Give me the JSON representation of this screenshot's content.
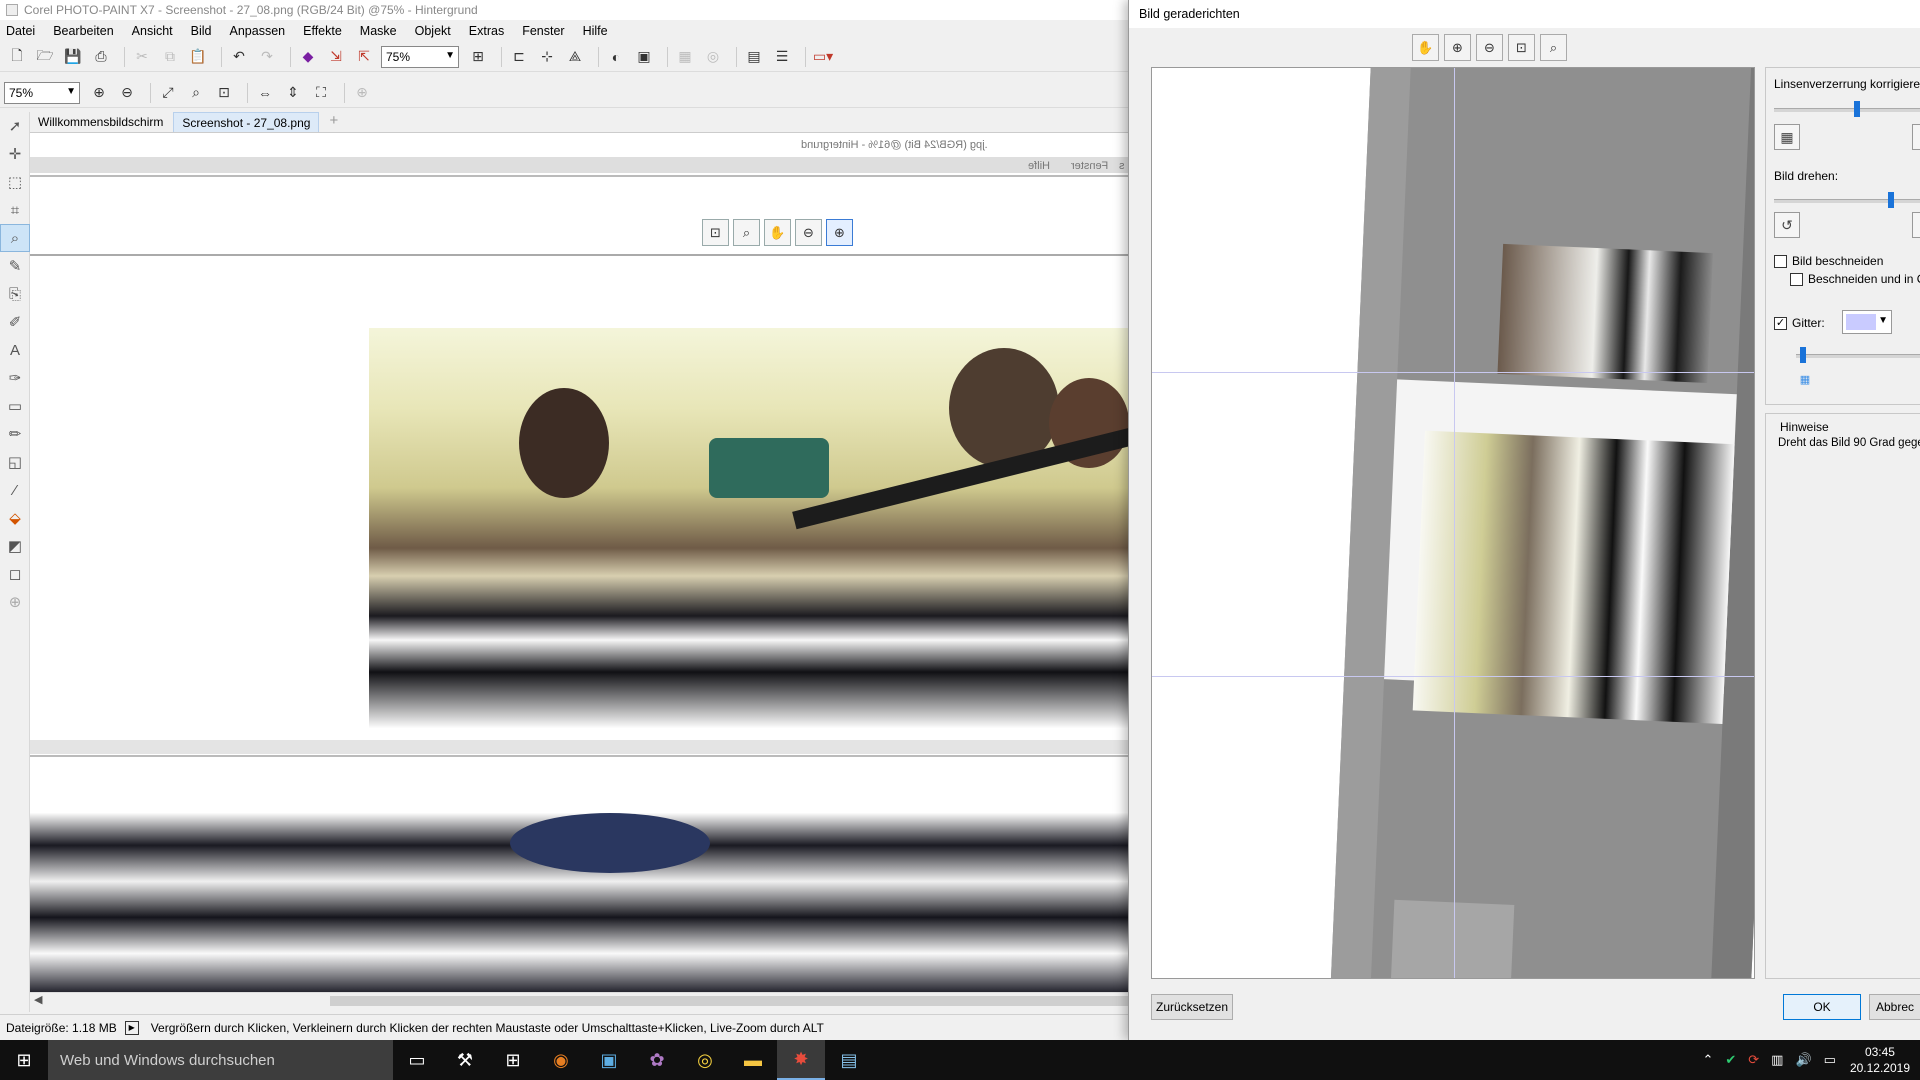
{
  "app": {
    "title": "Corel PHOTO-PAINT X7 - Screenshot - 27_08.png (RGB/24 Bit) @75% - Hintergrund",
    "menu": [
      "Datei",
      "Bearbeiten",
      "Ansicht",
      "Bild",
      "Anpassen",
      "Effekte",
      "Maske",
      "Objekt",
      "Extras",
      "Fenster",
      "Hilfe"
    ],
    "zoom_main": "75%",
    "zoom_secondary": "75%",
    "tabs": [
      "Willkommensbildschirm",
      "Screenshot - 27_08.png"
    ],
    "tab_add": "+",
    "mirrored_title": ".jpg (RGB/24 Bit) @61% - Hintergrund",
    "mirrored_menu": [
      "Hilfe",
      "Fenster",
      "s"
    ]
  },
  "status": {
    "filesize": "Dateigröße: 1.18 MB",
    "hint": "Vergrößern durch Klicken, Verkleinern durch Klicken der rechten Maustaste oder Umschalttaste+Klicken, Live-Zoom durch ALT"
  },
  "dialog": {
    "title": "Bild geraderichten",
    "lens_label": "Linsenverzerrung korrigieren",
    "rotate_label": "Bild drehen:",
    "crop_label": "Bild beschneiden",
    "crop_fit_label": "Beschneiden und in O",
    "grid_label": "Gitter:",
    "grid_color": "#c9cbff",
    "hints_title": "Hinweise",
    "hints_text": "Dreht das Bild 90 Grad gegen",
    "reset_button": "Zurücksetzen",
    "ok_button": "OK",
    "cancel_button": "Abbrec",
    "crop_checked": false,
    "crop_fit_checked": false,
    "grid_checked": true
  },
  "taskbar": {
    "search_placeholder": "Web und Windows durchsuchen",
    "time": "03:45",
    "date": "20.12.2019"
  },
  "colors": {
    "accent": "#1a73d9",
    "taskbar": "#101010"
  }
}
